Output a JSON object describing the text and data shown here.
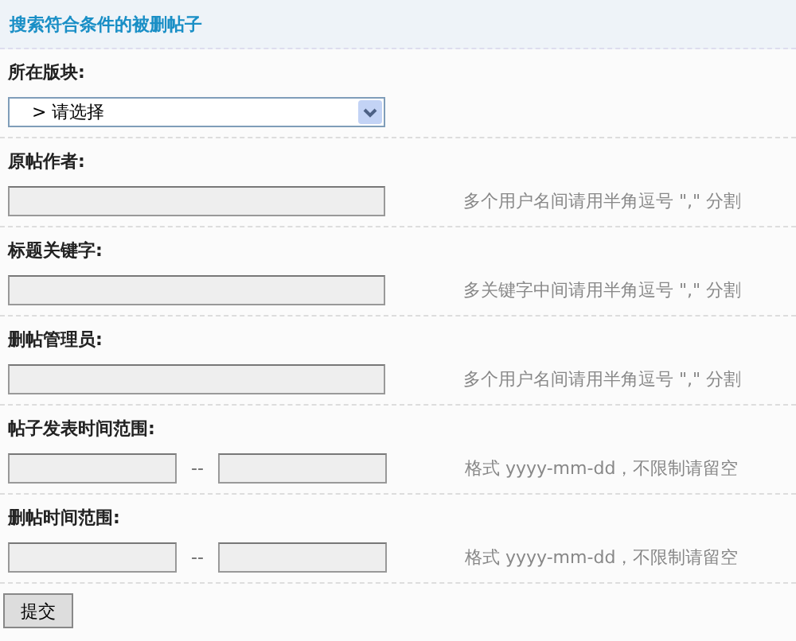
{
  "title": "搜索符合条件的被删帖子",
  "fields": [
    {
      "kind": "select",
      "label": "所在版块:",
      "value": "> 请选择"
    },
    {
      "kind": "text",
      "label": "原帖作者:",
      "hint": "多个用户名间请用半角逗号 \",\" 分割"
    },
    {
      "kind": "text",
      "label": "标题关键字:",
      "hint": "多关键字中间请用半角逗号 \",\" 分割"
    },
    {
      "kind": "text",
      "label": "删帖管理员:",
      "hint": "多个用户名间请用半角逗号 \",\" 分割"
    },
    {
      "kind": "range",
      "label": "帖子发表时间范围:",
      "separator": "--",
      "hint": "格式 yyyy-mm-dd，不限制请留空"
    },
    {
      "kind": "range",
      "label": "删帖时间范围:",
      "separator": "--",
      "hint": "格式 yyyy-mm-dd，不限制请留空"
    }
  ],
  "submit": "提交"
}
